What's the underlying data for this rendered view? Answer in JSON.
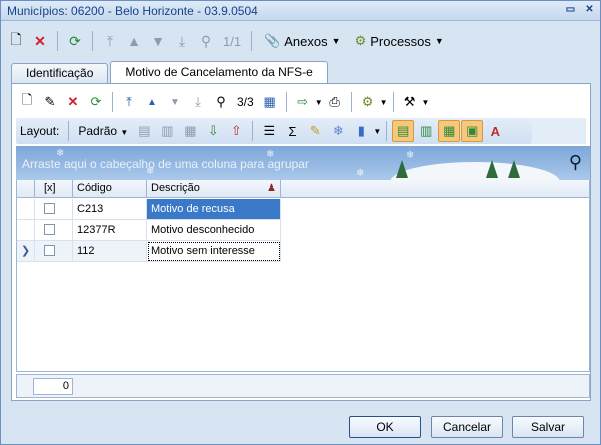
{
  "window": {
    "title": "Municípios: 06200 - Belo Horizonte - 03.9.0504"
  },
  "toolbar1": {
    "page_indicator": "1/1",
    "anexos_label": "Anexos",
    "processos_label": "Processos"
  },
  "tabs": [
    {
      "label": "Identificação"
    },
    {
      "label": "Motivo de Cancelamento da NFS-e"
    }
  ],
  "toolbar2": {
    "page_indicator": "3/3"
  },
  "toolbar3": {
    "layout_label": "Layout:",
    "layout_value": "Padrão"
  },
  "group_panel": {
    "hint": "Arraste aqui o cabeçalho de uma coluna para agrupar"
  },
  "grid": {
    "columns": [
      "[x]",
      "Código",
      "Descrição"
    ],
    "rows": [
      {
        "code": "C213",
        "description": "Motivo de recusa"
      },
      {
        "code": "12377R",
        "description": "Motivo desconhecido"
      },
      {
        "code": "112",
        "description": "Motivo sem interesse"
      }
    ]
  },
  "footer": {
    "count": "0"
  },
  "buttons": {
    "ok": "OK",
    "cancel": "Cancelar",
    "save": "Salvar"
  }
}
